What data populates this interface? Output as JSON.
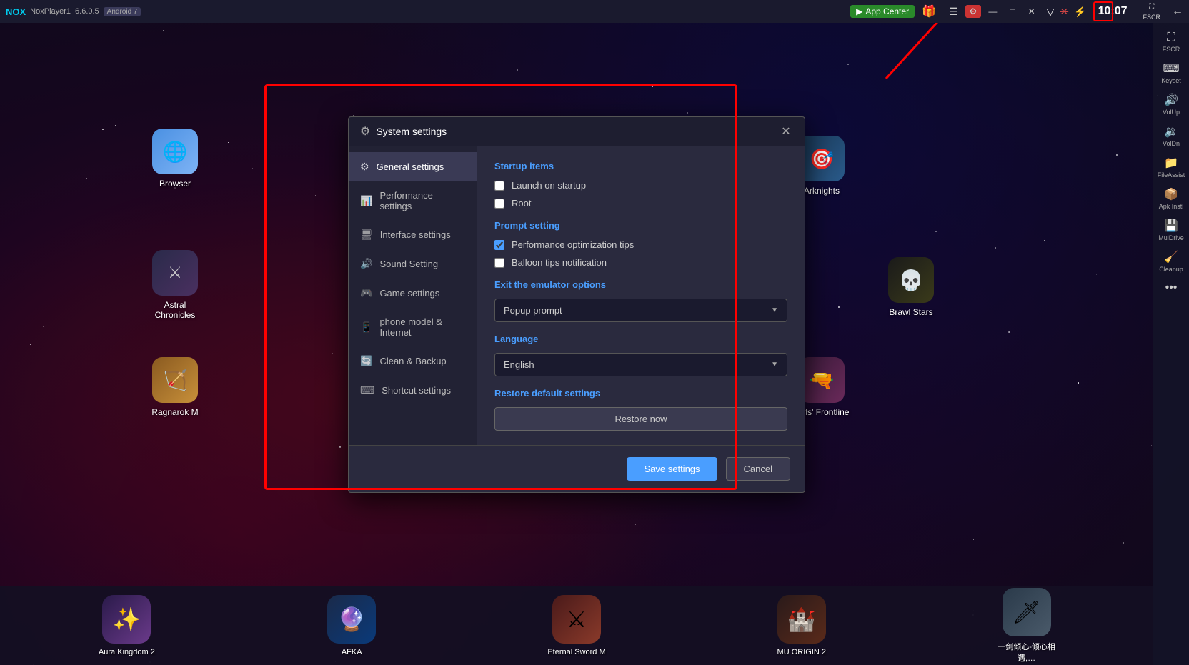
{
  "topbar": {
    "app_name": "NoxPlayer1",
    "version": "6.6.0.5",
    "android": "Android 7",
    "app_center_label": "App Center",
    "time": "10:07",
    "window_controls": [
      "minimize",
      "maximize",
      "close"
    ],
    "fscr_label": "FSCR",
    "keyset_label": "Keyset",
    "vol_up_label": "VolUp",
    "vol_dn_label": "VolDn",
    "file_assist_label": "FileAssist",
    "apk_inst_label": "Apk Instl",
    "mul_drive_label": "MulDrive",
    "cleanup_label": "Cleanup"
  },
  "dialog": {
    "title": "System settings",
    "nav_items": [
      {
        "label": "General settings",
        "icon": "⚙",
        "active": true
      },
      {
        "label": "Performance settings",
        "icon": "📊",
        "active": false
      },
      {
        "label": "Interface settings",
        "icon": "🖥",
        "active": false
      },
      {
        "label": "Sound Setting",
        "icon": "🔊",
        "active": false
      },
      {
        "label": "Game settings",
        "icon": "🎮",
        "active": false
      },
      {
        "label": "phone model & Internet",
        "icon": "📱",
        "active": false
      },
      {
        "label": "Clean & Backup",
        "icon": "🔄",
        "active": false
      },
      {
        "label": "Shortcut settings",
        "icon": "⌨",
        "active": false
      }
    ],
    "content": {
      "startup_section": "Startup items",
      "launch_on_startup_label": "Launch on startup",
      "launch_on_startup_checked": false,
      "root_label": "Root",
      "root_checked": false,
      "prompt_section": "Prompt setting",
      "perf_tips_label": "Performance optimization tips",
      "perf_tips_checked": true,
      "balloon_tips_label": "Balloon tips notification",
      "balloon_tips_checked": false,
      "exit_section": "Exit the emulator options",
      "exit_dropdown_value": "Popup prompt",
      "language_section": "Language",
      "language_dropdown_value": "English",
      "restore_section": "Restore default settings",
      "restore_btn_label": "Restore now"
    },
    "footer": {
      "save_label": "Save settings",
      "cancel_label": "Cancel"
    }
  },
  "desktop_icons": [
    {
      "label": "Browser",
      "color": "browser-icon",
      "emoji": "🌐"
    },
    {
      "label": "Astral Chronicles",
      "color": "astral-icon",
      "emoji": "⚔"
    },
    {
      "label": "Ragnarok M",
      "color": "ragnarok-icon",
      "emoji": "🏹"
    },
    {
      "label": "Arknights",
      "color": "arknights-icon",
      "emoji": "🎯"
    },
    {
      "label": "Brawl Stars",
      "color": "brawl-icon",
      "emoji": "💀"
    },
    {
      "label": "Girls' Frontline",
      "color": "frontline-icon",
      "emoji": "🔫"
    }
  ],
  "bottom_apps": [
    {
      "label": "Aura Kingdom 2",
      "color": "aura-icon",
      "emoji": "✨"
    },
    {
      "label": "AFKA",
      "color": "afka-icon",
      "emoji": "🔮"
    },
    {
      "label": "Eternal Sword M",
      "color": "eternal-icon",
      "emoji": "⚔"
    },
    {
      "label": "MU ORIGIN 2",
      "color": "mu-icon",
      "emoji": "🏰"
    },
    {
      "label": "一剑倾心-倾心相遇,…",
      "color": "sword-icon",
      "emoji": "🗡"
    }
  ],
  "right_sidebar": [
    {
      "label": "FSCR",
      "icon": "⛶"
    },
    {
      "label": "Keyset",
      "icon": "⌨"
    },
    {
      "label": "VolUp",
      "icon": "🔊"
    },
    {
      "label": "VolDn",
      "icon": "🔉"
    },
    {
      "label": "FileAssist",
      "icon": "📁"
    },
    {
      "label": "Apk Instl",
      "icon": "📦"
    },
    {
      "label": "MulDrive",
      "icon": "💾"
    },
    {
      "label": "Cleanup",
      "icon": "🧹"
    },
    {
      "label": "...",
      "icon": "…"
    }
  ]
}
